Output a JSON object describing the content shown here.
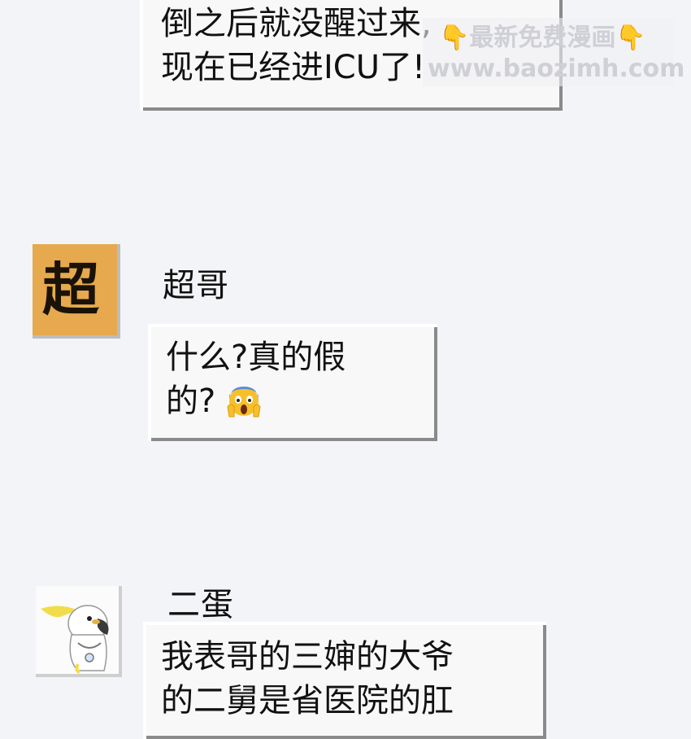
{
  "messages": [
    {
      "sender": "",
      "lines": [
        "倒之后就没醒过来,",
        "现在已经进ICU了!"
      ]
    },
    {
      "sender": "超哥",
      "avatar_char": "超",
      "lines": [
        "什么?真的假",
        "的?"
      ],
      "emoji": "screaming-face-emoji"
    },
    {
      "sender": "二蛋",
      "avatar": "cockatoo-avatar",
      "lines": [
        "我表哥的三婶的大爷",
        "的二舅是省医院的肛"
      ]
    }
  ],
  "watermark": {
    "line1": "最新免费漫画",
    "line2": "www.baozimh.com",
    "icon": "pointing-down-hand-icon"
  },
  "colors": {
    "background": "#f3f4f8",
    "bubble": "#f8f8f8",
    "bubble_shadow": "#8a8a8a",
    "avatar_chao_bg": "#e6a94d"
  }
}
